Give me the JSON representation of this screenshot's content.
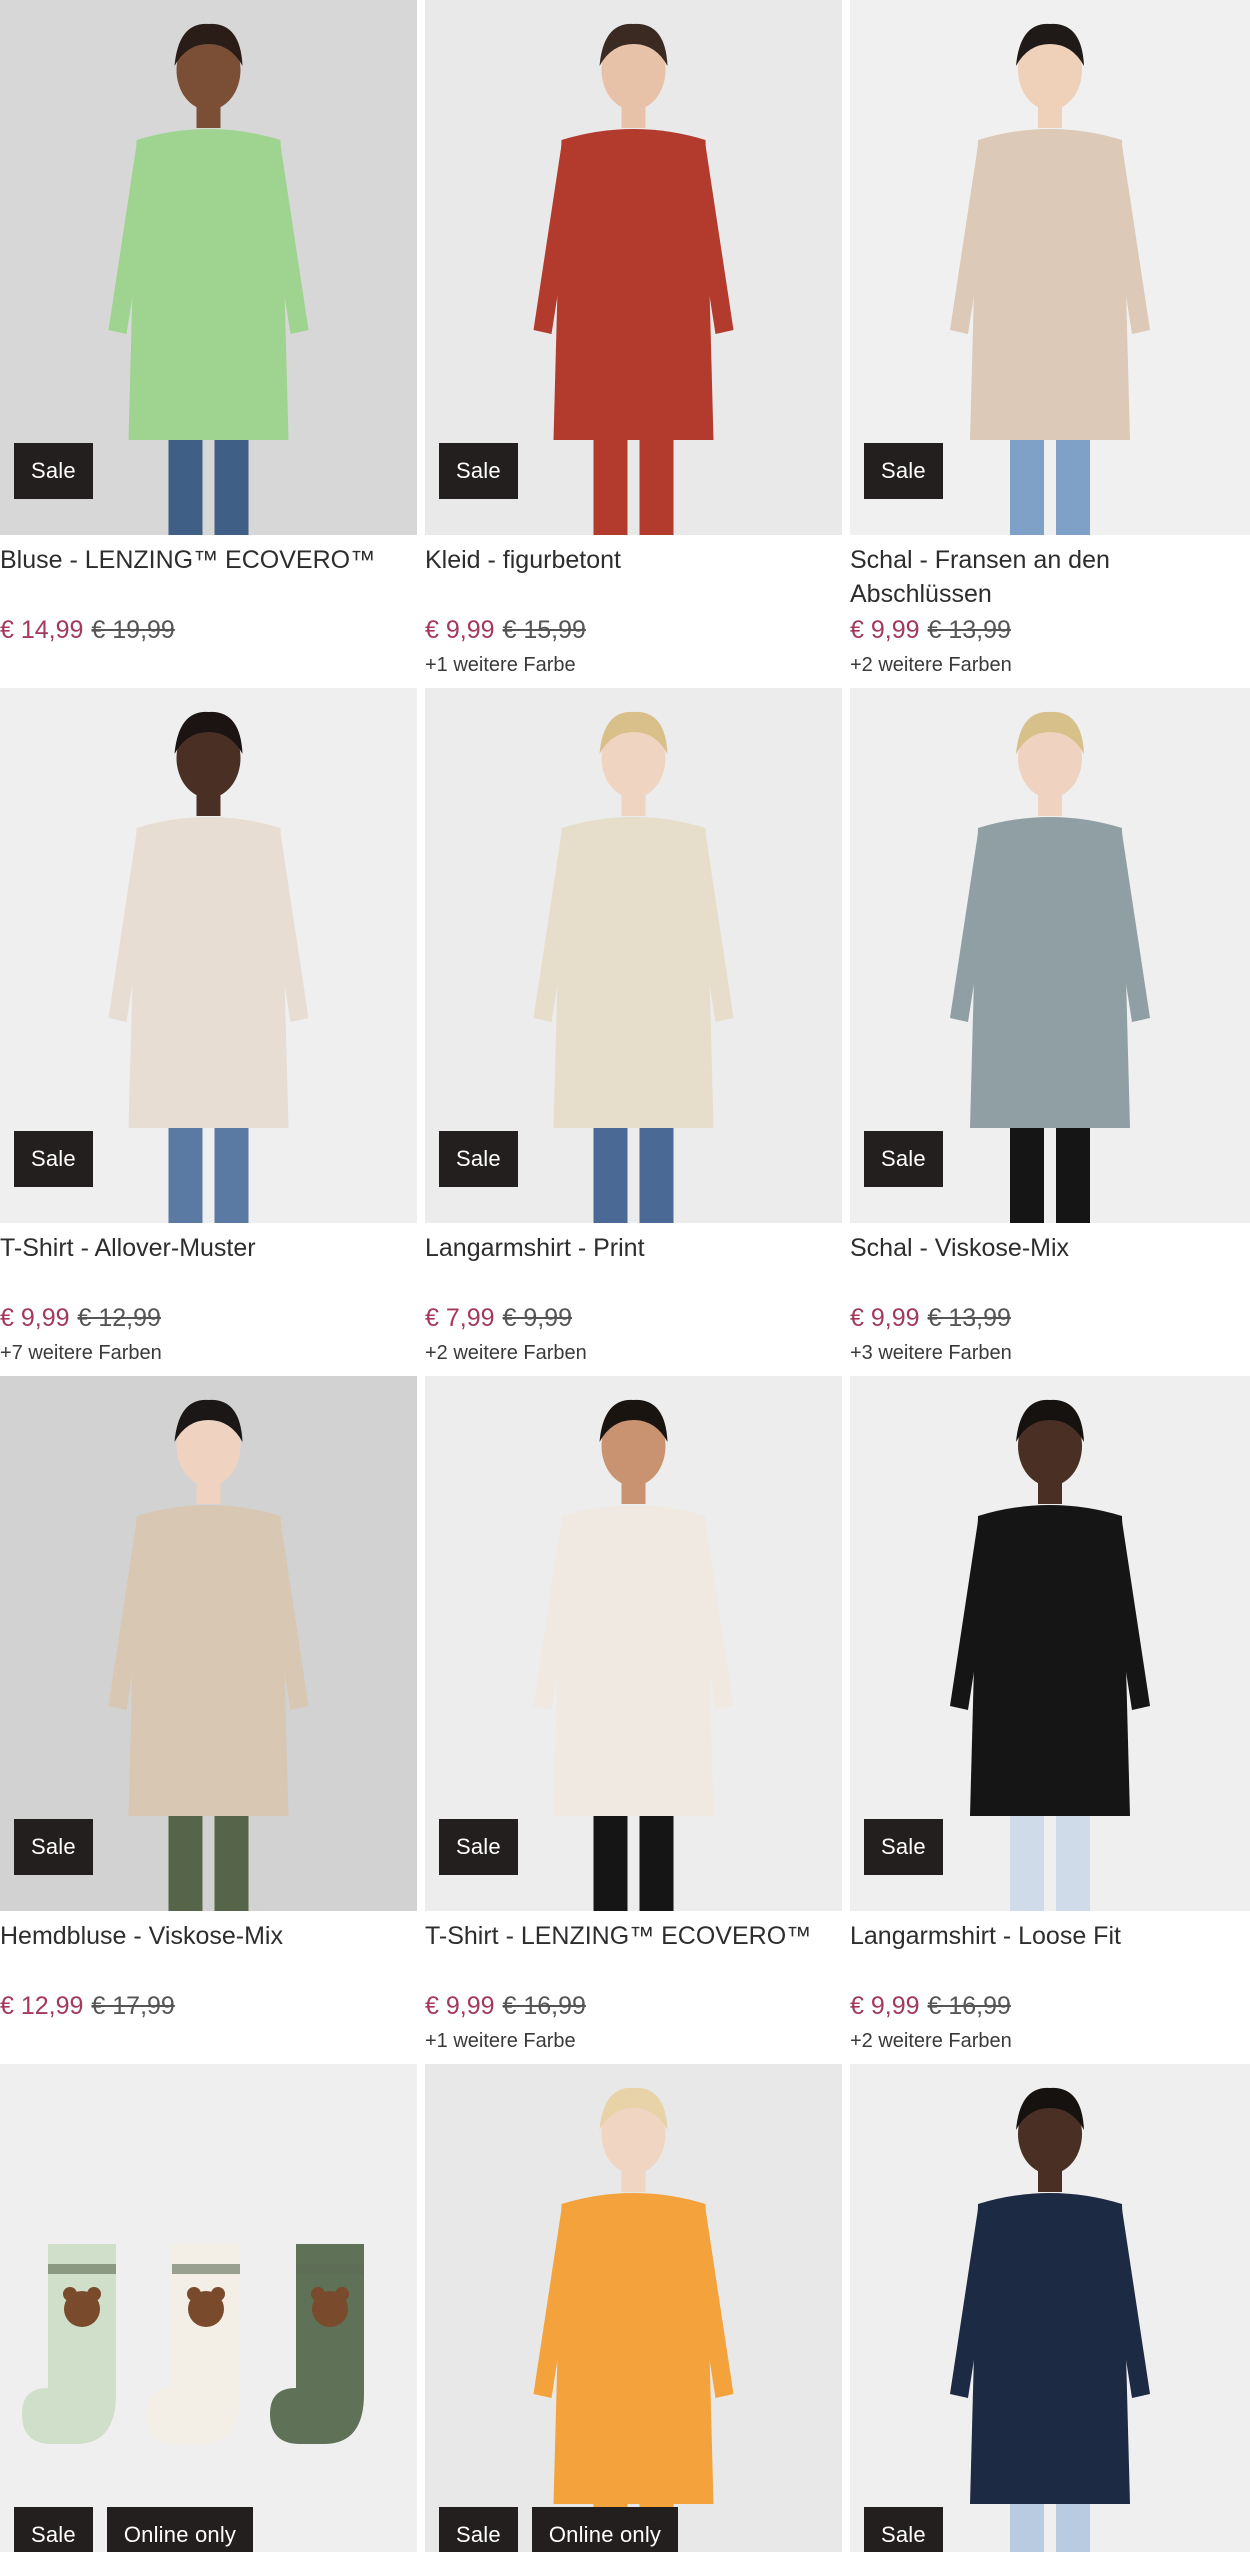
{
  "products": [
    {
      "title": "Bluse - LENZING™ ECOVERO™",
      "price": "€ 14,99",
      "old_price": "€ 19,99",
      "colors": "",
      "badges": [
        "Sale"
      ],
      "img": {
        "bg": "#d7d7d7",
        "top": "#9ed48f",
        "bottom": "#3f5f86",
        "skin": "#7a4f36",
        "hair": "#2a1d17"
      }
    },
    {
      "title": "Kleid - figurbetont",
      "price": "€ 9,99",
      "old_price": "€ 15,99",
      "colors": "+1 weitere Farbe",
      "badges": [
        "Sale"
      ],
      "img": {
        "bg": "#e9e9e9",
        "top": "#b23b2e",
        "bottom": "#b23b2e",
        "skin": "#e8c2a8",
        "hair": "#3a2a22"
      }
    },
    {
      "title": "Schal - Fransen an den Abschlüssen",
      "price": "€ 9,99",
      "old_price": "€ 13,99",
      "colors": "+2 weitere Farben",
      "badges": [
        "Sale"
      ],
      "img": {
        "bg": "#f0f0f0",
        "top": "#dcc9b8",
        "bottom": "#7fa1c7",
        "skin": "#efd0b8",
        "hair": "#1f1a18"
      }
    },
    {
      "title": "T-Shirt - Allover-Muster",
      "price": "€ 9,99",
      "old_price": "€ 12,99",
      "colors": "+7 weitere Farben",
      "badges": [
        "Sale"
      ],
      "img": {
        "bg": "#efefef",
        "top": "#e7ddd3",
        "bottom": "#5a7aa3",
        "skin": "#4a2f24",
        "hair": "#1b1412"
      }
    },
    {
      "title": "Langarmshirt - Print",
      "price": "€ 7,99",
      "old_price": "€ 9,99",
      "colors": "+2 weitere Farben",
      "badges": [
        "Sale"
      ],
      "img": {
        "bg": "#ececec",
        "top": "#e6ddca",
        "bottom": "#4a6a95",
        "skin": "#f0d4c2",
        "hair": "#d9bf8a"
      }
    },
    {
      "title": "Schal - Viskose-Mix",
      "price": "€ 9,99",
      "old_price": "€ 13,99",
      "colors": "+3 weitere Farben",
      "badges": [
        "Sale"
      ],
      "img": {
        "bg": "#efefef",
        "top": "#8f9fa3",
        "bottom": "#151515",
        "skin": "#efd3c0",
        "hair": "#d8c08b"
      }
    },
    {
      "title": "Hemdbluse - Viskose-Mix",
      "price": "€ 12,99",
      "old_price": "€ 17,99",
      "colors": "",
      "badges": [
        "Sale"
      ],
      "img": {
        "bg": "#d2d2d2",
        "top": "#d8c7b2",
        "bottom": "#56654a",
        "skin": "#efd3c0",
        "hair": "#1a1716"
      }
    },
    {
      "title": "T-Shirt - LENZING™ ECOVERO™",
      "price": "€ 9,99",
      "old_price": "€ 16,99",
      "colors": "+1 weitere Farbe",
      "badges": [
        "Sale"
      ],
      "img": {
        "bg": "#ededed",
        "top": "#efe9e2",
        "bottom": "#151515",
        "skin": "#c99270",
        "hair": "#1a1411"
      }
    },
    {
      "title": "Langarmshirt - Loose Fit",
      "price": "€ 9,99",
      "old_price": "€ 16,99",
      "colors": "+2 weitere Farben",
      "badges": [
        "Sale"
      ],
      "img": {
        "bg": "#efefef",
        "top": "#151515",
        "bottom": "#cfdbe8",
        "skin": "#4a2f24",
        "hair": "#151210"
      }
    },
    {
      "title": "",
      "price": "",
      "old_price": "",
      "colors": "",
      "badges": [
        "Sale",
        "Online only"
      ],
      "img": {
        "bg": "#efefef",
        "kind": "socks"
      }
    },
    {
      "title": "",
      "price": "",
      "old_price": "",
      "colors": "",
      "badges": [
        "Sale",
        "Online only"
      ],
      "img": {
        "bg": "#e8e8e8",
        "top": "#f3a23c",
        "bottom": "#f3a23c",
        "skin": "#f1d5c3",
        "hair": "#e8d2a8"
      }
    },
    {
      "title": "",
      "price": "",
      "old_price": "",
      "colors": "",
      "badges": [
        "Sale"
      ],
      "img": {
        "bg": "#efefef",
        "top": "#1d2a44",
        "bottom": "#b8cbe0",
        "skin": "#4a2f24",
        "hair": "#151210"
      }
    }
  ]
}
